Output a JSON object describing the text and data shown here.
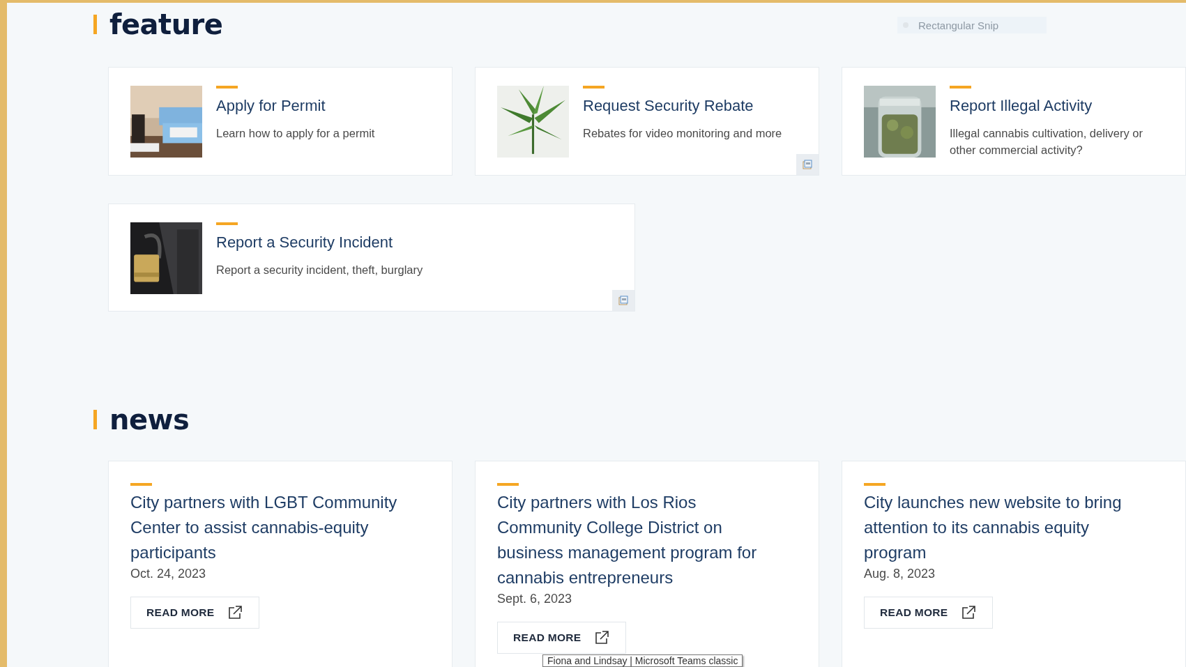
{
  "snip_toolbar": {
    "label": "Rectangular Snip"
  },
  "feature": {
    "heading": "feature",
    "cards": [
      {
        "title": "Apply for Permit",
        "description": "Learn how to apply for a permit",
        "pdf": false
      },
      {
        "title": "Request Security Rebate",
        "description": "Rebates for video monitoring and more",
        "pdf": true
      },
      {
        "title": "Report Illegal Activity",
        "description": "Illegal cannabis cultivation, delivery or other commercial activity?",
        "pdf": false
      },
      {
        "title": "Report a Security Incident",
        "description": "Report a security incident, theft, burglary",
        "pdf": true
      }
    ]
  },
  "news": {
    "heading": "news",
    "items": [
      {
        "title": "City partners with LGBT Community Center to assist cannabis-equity participants",
        "date": "Oct. 24, 2023",
        "button": "READ MORE"
      },
      {
        "title": "City partners with Los Rios Community College District on business management program for cannabis entrepreneurs",
        "date": "Sept. 6, 2023",
        "button": "READ MORE"
      },
      {
        "title": "City launches new website to bring attention to its cannabis equity program",
        "date": "Aug. 8, 2023",
        "button": "READ MORE"
      }
    ]
  },
  "tooltip": {
    "text": "Fiona and Lindsay | Microsoft Teams classic"
  }
}
